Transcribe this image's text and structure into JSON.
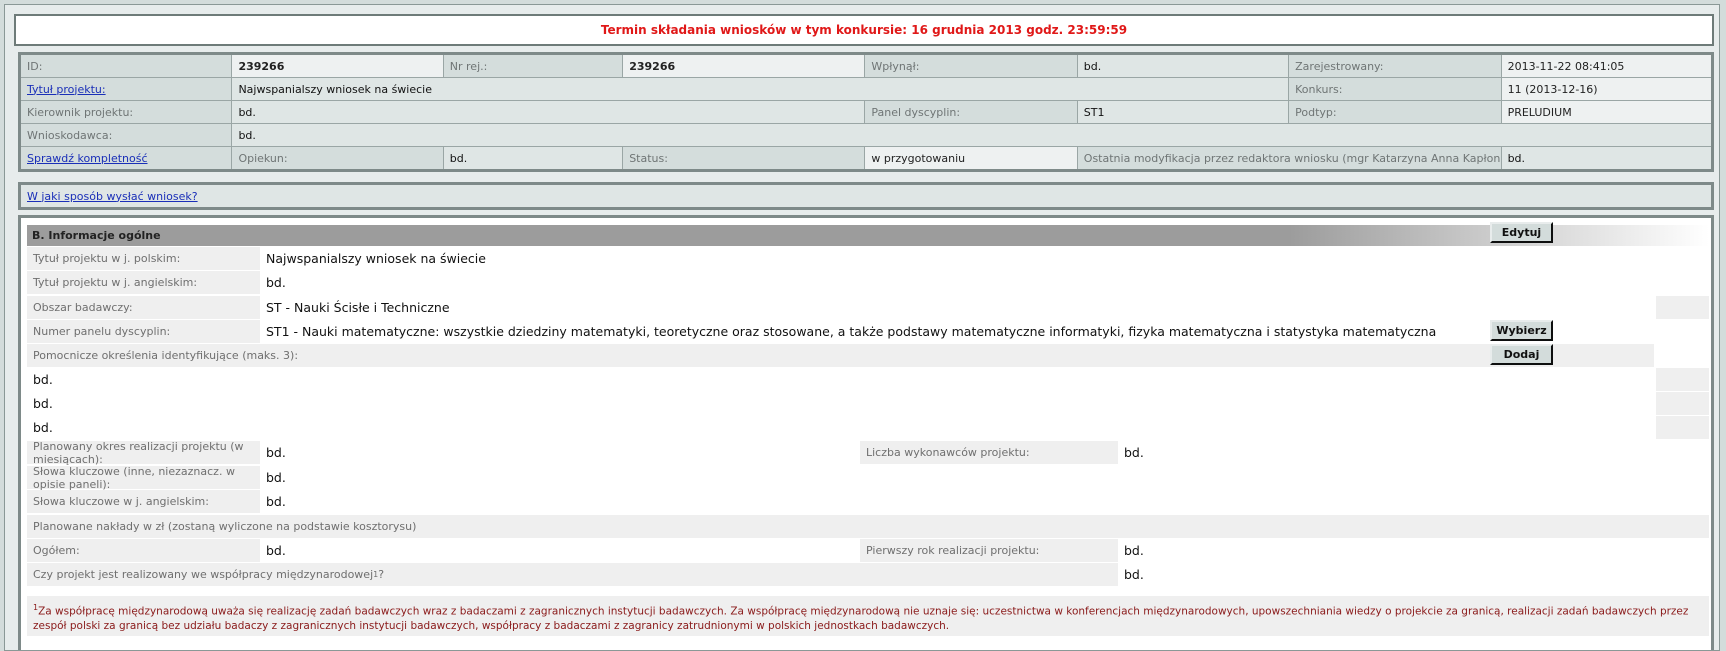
{
  "deadline": "Termin składania wniosków w tym konkursie: 16 grudnia 2013 godz. 23:59:59",
  "info": {
    "id_label": "ID:",
    "id_value": "239266",
    "nrrej_label": "Nr rej.:",
    "nrrej_value": "239266",
    "wplynal_label": "Wpłynął:",
    "wplynal_value": "bd.",
    "zarej_label": "Zarejestrowany:",
    "zarej_value": "2013-11-22 08:41:05",
    "tytul_link": "Tytuł projektu:",
    "tytul_value": "Najwspanialszy wniosek na świecie",
    "konkurs_label": "Konkurs:",
    "konkurs_value": "11 (2013-12-16)",
    "kierownik_label": "Kierownik projektu:",
    "kierownik_value": "bd.",
    "panel_label": "Panel dyscyplin:",
    "panel_value": "ST1",
    "podtyp_label": "Podtyp:",
    "podtyp_value": "PRELUDIUM",
    "wnioskodawca_label": "Wnioskodawca:",
    "wnioskodawca_value": "bd.",
    "sprawdz_link": "Sprawdź kompletność",
    "opiekun_label": "Opiekun:",
    "opiekun_value": "bd.",
    "status_label": "Status:",
    "status_value": "w przygotowaniu",
    "ostatnia_label": "Ostatnia modyfikacja przez redaktora wniosku (mgr Katarzyna Anna Kapłon):",
    "ostatnia_value": "bd."
  },
  "howto_link": "W jaki sposób wysłać wniosek?",
  "section": {
    "title": "B. Informacje ogólne",
    "edit_button": "Edytuj",
    "choose_button": "Wybierz",
    "add_button": "Dodaj",
    "tytul_pl_label": "Tytuł projektu w j. polskim:",
    "tytul_pl_value": "Najwspanialszy wniosek na świecie",
    "tytul_en_label": "Tytuł projektu w j. angielskim:",
    "tytul_en_value": "bd.",
    "obszar_label": "Obszar badawczy:",
    "obszar_value": "ST - Nauki Ścisłe i Techniczne",
    "numer_panelu_label": "Numer panelu dyscyplin:",
    "numer_panelu_value": "ST1 - Nauki matematyczne: wszystkie dziedziny matematyki, teoretyczne oraz stosowane, a także podstawy matematyczne informatyki, fizyka matematyczna i statystyka matematyczna",
    "pomocnicze_label": "Pomocnicze określenia identyfikujące (maks. 3):",
    "pomocnicze_values": [
      "bd.",
      "bd.",
      "bd."
    ],
    "okres_label": "Planowany okres realizacji projektu (w miesiącach):",
    "okres_value": "bd.",
    "liczba_label": "Liczba wykonawców projektu:",
    "liczba_value": "bd.",
    "slowa_label": "Słowa kluczowe (inne, niezaznacz. w opisie paneli):",
    "slowa_value": "bd.",
    "slowa_en_label": "Słowa kluczowe w j. angielskim:",
    "slowa_en_value": "bd.",
    "naklady_label": "Planowane nakłady w zł (zostaną wyliczone na podstawie kosztorysu)",
    "ogolem_label": "Ogółem:",
    "ogolem_value": "bd.",
    "pierwszy_label": "Pierwszy rok realizacji projektu:",
    "pierwszy_value": "bd.",
    "wspolpraca_label": "Czy projekt jest realizowany we współpracy międzynarodowej",
    "wspolpraca_sup": "1",
    "wspolpraca_q": "?",
    "wspolpraca_value": "bd.",
    "note_sup": "1",
    "note_text": "Za współpracę międzynarodową uważa się realizację zadań badawczych wraz z badaczami z zagranicznych instytucji badawczych. Za współpracę międzynarodową nie uznaje się: uczestnictwa w konferencjach międzynarodowych, upowszechniania wiedzy o projekcie za granicą, realizacji zadań badawczych przez zespół polski za granicą bez udziału badaczy z zagranicznych instytucji badawczych, współpracy z badaczami z zagranicy zatrudnionymi w polskich jednostkach badawczych."
  }
}
